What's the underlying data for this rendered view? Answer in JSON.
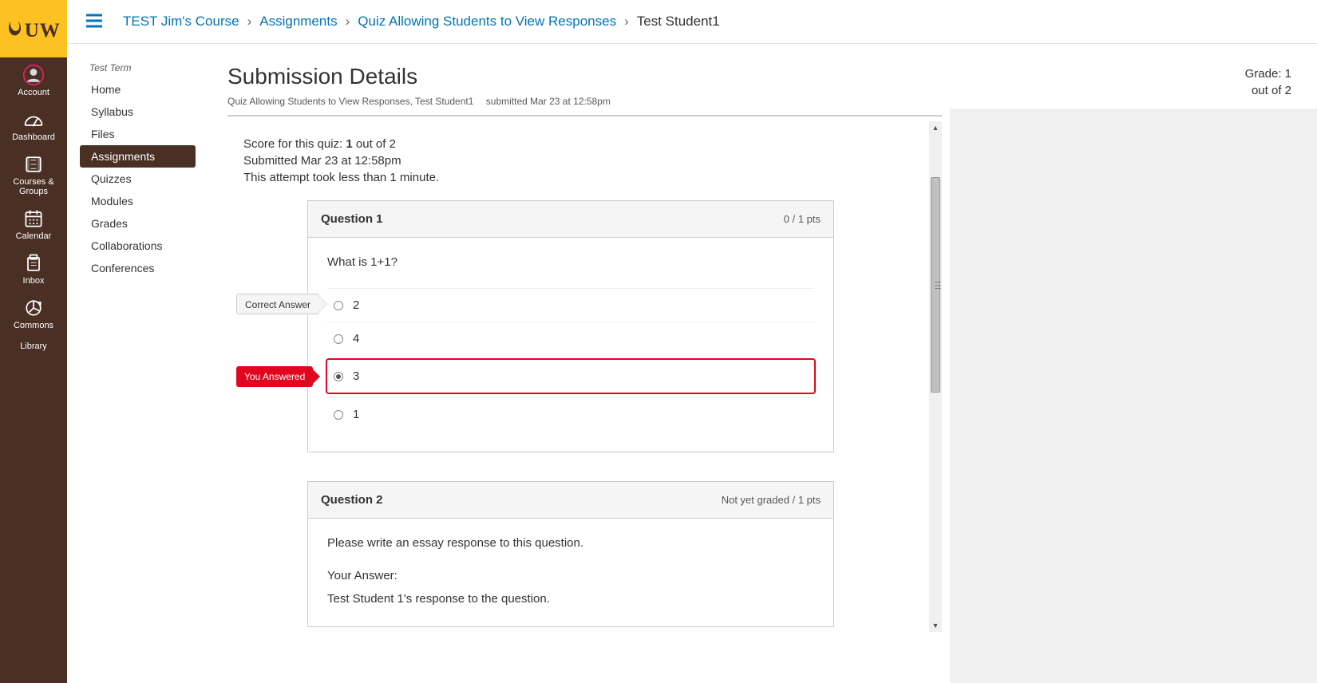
{
  "logo_text": "UW",
  "global_nav": [
    {
      "id": "account",
      "label": "Account"
    },
    {
      "id": "dashboard",
      "label": "Dashboard"
    },
    {
      "id": "courses",
      "label": "Courses & Groups"
    },
    {
      "id": "calendar",
      "label": "Calendar"
    },
    {
      "id": "inbox",
      "label": "Inbox"
    },
    {
      "id": "commons",
      "label": "Commons"
    },
    {
      "id": "library",
      "label": "Library"
    }
  ],
  "breadcrumbs": {
    "items": [
      {
        "label": "TEST Jim's Course",
        "link": true
      },
      {
        "label": "Assignments",
        "link": true
      },
      {
        "label": "Quiz Allowing Students to View Responses",
        "link": true
      },
      {
        "label": "Test Student1",
        "link": false
      }
    ]
  },
  "course_nav": {
    "term": "Test Term",
    "items": [
      {
        "label": "Home"
      },
      {
        "label": "Syllabus"
      },
      {
        "label": "Files"
      },
      {
        "label": "Assignments",
        "active": true
      },
      {
        "label": "Quizzes"
      },
      {
        "label": "Modules"
      },
      {
        "label": "Grades"
      },
      {
        "label": "Collaborations"
      },
      {
        "label": "Conferences"
      }
    ]
  },
  "page": {
    "title": "Submission Details",
    "sub_left": "Quiz Allowing Students to View Responses, Test Student1",
    "sub_right": "submitted Mar 23 at 12:58pm"
  },
  "grade": {
    "line1": "Grade: 1",
    "line2": "out of 2"
  },
  "quiz_meta": {
    "score_prefix": "Score for this quiz: ",
    "score_value": "1",
    "score_suffix": " out of 2",
    "submitted": "Submitted Mar 23 at 12:58pm",
    "duration": "This attempt took less than 1 minute."
  },
  "tags": {
    "correct": "Correct Answer",
    "you": "You Answered"
  },
  "questions": [
    {
      "title": "Question 1",
      "pts": "0 / 1 pts",
      "text": "What is 1+1?",
      "type": "mc",
      "options": [
        {
          "label": "2",
          "correct": true,
          "selected": false
        },
        {
          "label": "4",
          "correct": false,
          "selected": false
        },
        {
          "label": "3",
          "correct": false,
          "selected": true,
          "wrong": true
        },
        {
          "label": "1",
          "correct": false,
          "selected": false
        }
      ]
    },
    {
      "title": "Question 2",
      "pts": "Not yet graded / 1 pts",
      "text": "Please write an essay response to this question.",
      "type": "essay",
      "your_answer_label": "Your Answer:",
      "response": "Test Student 1's response to the question."
    }
  ]
}
